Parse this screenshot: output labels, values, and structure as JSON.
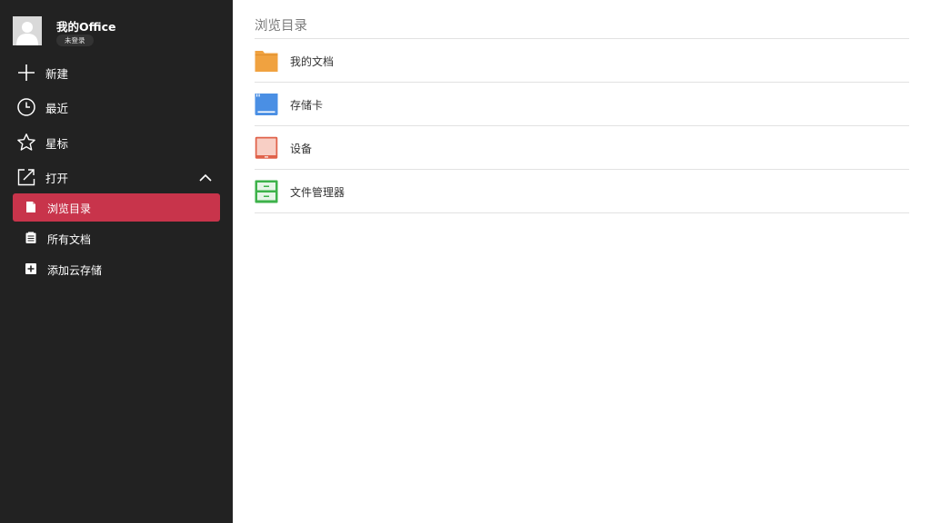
{
  "sidebar": {
    "profile": {
      "app_name": "我的Office",
      "login_status": "未登录"
    },
    "nav": [
      {
        "label": "新建",
        "icon": "plus-icon"
      },
      {
        "label": "最近",
        "icon": "clock-icon"
      },
      {
        "label": "星标",
        "icon": "star-icon"
      },
      {
        "label": "打开",
        "icon": "open-external-icon",
        "expanded": true
      }
    ],
    "open_submenu": [
      {
        "label": "浏览目录",
        "icon": "document-icon",
        "active": true
      },
      {
        "label": "所有文档",
        "icon": "list-document-icon",
        "active": false
      },
      {
        "label": "添加云存储",
        "icon": "add-square-icon",
        "active": false
      }
    ]
  },
  "main": {
    "title": "浏览目录",
    "items": [
      {
        "label": "我的文档",
        "icon": "folder-icon",
        "color": "#f0a240"
      },
      {
        "label": "存储卡",
        "icon": "sd-card-icon",
        "color": "#4a8fe4"
      },
      {
        "label": "设备",
        "icon": "device-icon",
        "color": "#e0624a"
      },
      {
        "label": "文件管理器",
        "icon": "file-cabinet-icon",
        "color": "#3db24a"
      }
    ]
  },
  "colors": {
    "sidebar_bg": "#222222",
    "active_item": "#c8344b",
    "main_bg": "#ffffff"
  }
}
